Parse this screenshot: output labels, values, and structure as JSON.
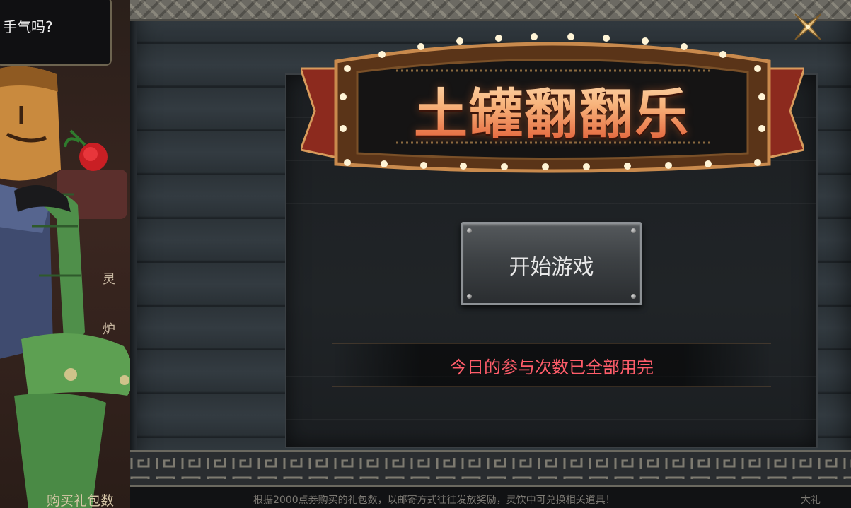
{
  "left_panel": {
    "speech_text": "手气吗?",
    "side_labels": [
      "灵",
      "炉"
    ],
    "buy_label": "购买礼包数"
  },
  "game": {
    "title": "土罐翻翻乐",
    "start_button_label": "开始游戏",
    "notice": "今日的参与次数已全部用完"
  },
  "footer": {
    "status_text": "根据2000点券购买的礼包数，以邮寄方式往往发放奖励，灵饮中可兑换相关道具！",
    "status_right": "大礼"
  },
  "icons": {
    "close": "close-x-icon"
  },
  "colors": {
    "title_gradient_top": "#ffe2b8",
    "title_gradient_bottom": "#e0552f",
    "notice": "#ff5d6a",
    "bulb": "#fff4d6"
  }
}
